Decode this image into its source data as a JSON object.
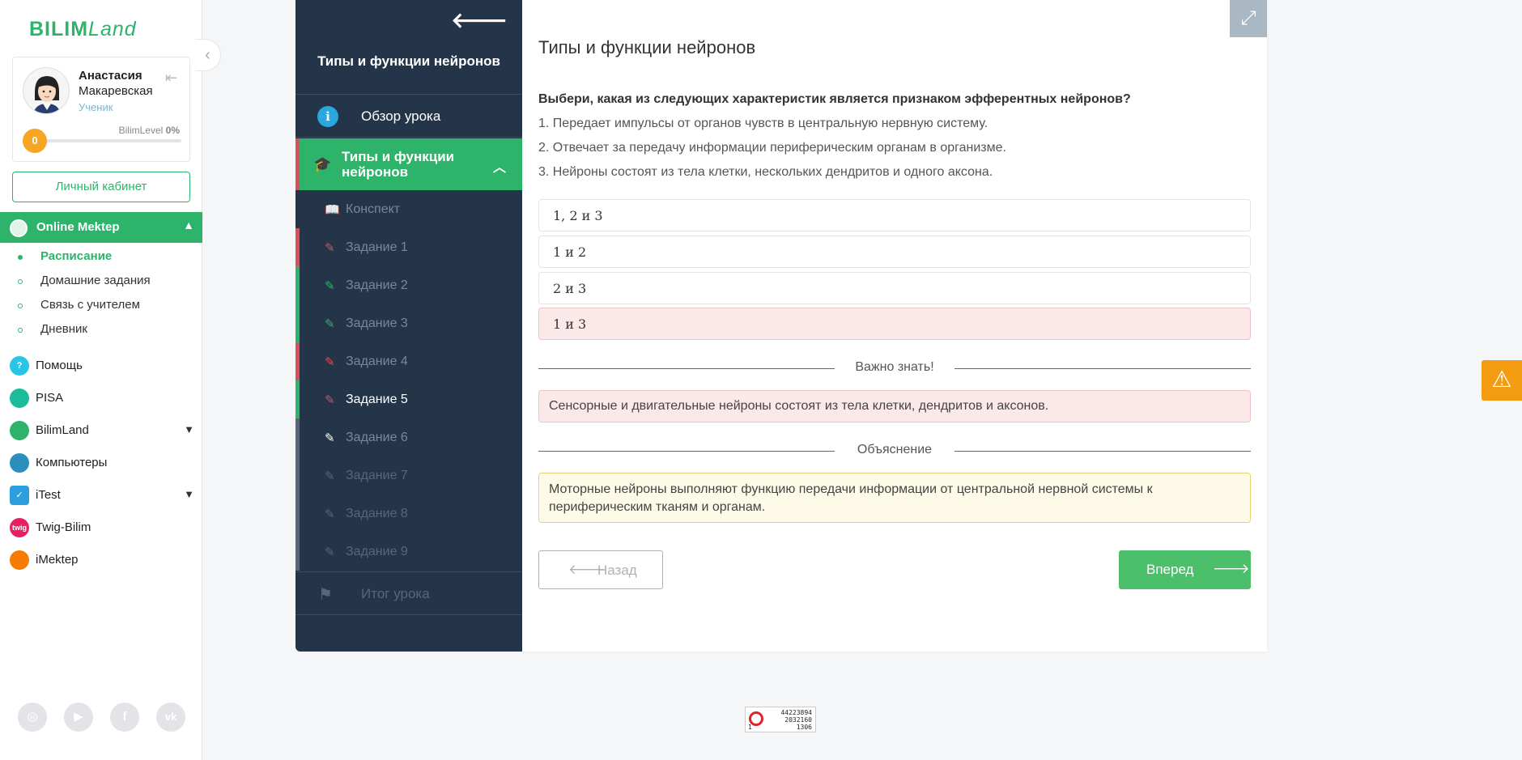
{
  "sidebar": {
    "logo": "BILIMLand",
    "logo_part1": "BILIM",
    "logo_part2": "Land",
    "user": {
      "first_name": "Анастасия",
      "last_name": "Макаревская",
      "role": "Ученик"
    },
    "bilimlevel_label": "BilimLevel",
    "bilimlevel_percent": "0%",
    "level_value": "0",
    "level_progress": 0,
    "cabinet_button": "Личный кабинет",
    "active_section": "Online Mektep",
    "subnav": [
      {
        "label": "Расписание",
        "selected": true
      },
      {
        "label": "Домашние задания",
        "selected": false
      },
      {
        "label": "Связь с учителем",
        "selected": false
      },
      {
        "label": "Дневник",
        "selected": false
      }
    ],
    "menu": [
      {
        "label": "Помощь",
        "icon": "help-icon",
        "badge": "?",
        "color": "#29c5e6",
        "chevron": false
      },
      {
        "label": "PISA",
        "icon": "pisa-icon",
        "badge": "",
        "color": "#1bbc9b",
        "chevron": false
      },
      {
        "label": "BilimLand",
        "icon": "bilimland-icon",
        "badge": "",
        "color": "#2eb36a",
        "chevron": true
      },
      {
        "label": "Компьютеры",
        "icon": "computers-icon",
        "badge": "",
        "color": "#2a8fbd",
        "chevron": false
      },
      {
        "label": "iTest",
        "icon": "itest-icon",
        "badge": "",
        "color": "#2d9fdf",
        "chevron": true
      },
      {
        "label": "Twig-Bilim",
        "icon": "twig-icon",
        "badge": "twig",
        "color": "#e91e63",
        "chevron": false
      },
      {
        "label": "iMektep",
        "icon": "imektep-icon",
        "badge": "",
        "color": "#f57c00",
        "chevron": false
      }
    ],
    "socials": [
      "instagram-icon",
      "youtube-icon",
      "facebook-icon",
      "vk-icon"
    ]
  },
  "lesson_nav": {
    "title": "Типы и функции нейронов",
    "overview": "Обзор урока",
    "topic": "Типы и функции нейронов",
    "tasks": [
      {
        "label": "Конспект",
        "status": "book"
      },
      {
        "label": "Задание 1",
        "status": "red"
      },
      {
        "label": "Задание 2",
        "status": "green"
      },
      {
        "label": "Задание 3",
        "status": "green"
      },
      {
        "label": "Задание 4",
        "status": "red"
      },
      {
        "label": "Задание 5",
        "status": "cur"
      },
      {
        "label": "Задание 6",
        "status": "open"
      },
      {
        "label": "Задание 7",
        "status": "lock"
      },
      {
        "label": "Задание 8",
        "status": "lock"
      },
      {
        "label": "Задание 9",
        "status": "lock"
      }
    ],
    "summary": "Итог урока"
  },
  "content": {
    "title": "Типы и функции нейронов",
    "question": "Выбери, какая из следующих характеристик является признаком эфферентных нейронов?",
    "statements": [
      "1. Передает импульсы от органов чувств в центральную нервную систему.",
      "2. Отвечает за передачу информации периферическим органам в организме.",
      "3. Нейроны состоят из тела клетки, нескольких дендритов и одного аксона."
    ],
    "options": [
      {
        "label": "1, 2 и 3",
        "state": "normal"
      },
      {
        "label": "1 и 2",
        "state": "normal"
      },
      {
        "label": "2 и 3",
        "state": "normal"
      },
      {
        "label": "1 и 3",
        "state": "wrong"
      }
    ],
    "important_title": "Важно знать!",
    "important_text": "Сенсорные и двигательные нейроны состоят из тела клетки, дендритов и аксонов.",
    "explanation_title": "Объяснение",
    "explanation_text": "Моторные нейроны выполняют функцию передачи информации от центральной нервной системы к периферическим тканям и органам.",
    "prev_button": "Назад",
    "next_button": "Вперед"
  },
  "counter": {
    "line1": "44223894",
    "line2": "2032160",
    "line3": "1306",
    "line0": "1"
  }
}
